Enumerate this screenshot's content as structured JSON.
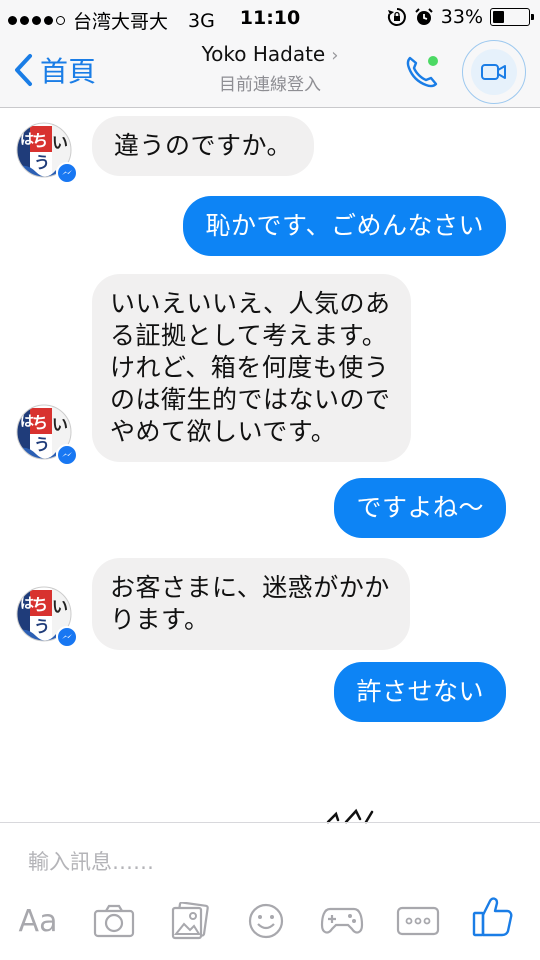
{
  "status_bar": {
    "carrier": "台湾大哥大",
    "network": "3G",
    "time": "11:10",
    "battery": "33%",
    "battery_level": 0.33
  },
  "header": {
    "back_label": "首頁",
    "contact_name": "Yoko Hadate",
    "contact_status": "目前連線登入"
  },
  "messages": [
    {
      "direction": "incoming",
      "text": "違うのですか。"
    },
    {
      "direction": "outgoing",
      "text": "恥かです、ごめんなさい"
    },
    {
      "direction": "incoming",
      "lines": [
        "いいえいいえ、人気のあ",
        "る証拠として考えます。",
        "けれど、箱を何度も使う",
        "のは衛生的ではないので",
        "やめて欲しいです。"
      ]
    },
    {
      "direction": "outgoing",
      "text": "ですよね〜"
    },
    {
      "direction": "incoming",
      "lines": [
        "お客さまに、迷惑がかか",
        "ります。"
      ]
    },
    {
      "direction": "outgoing",
      "text": "許させない"
    }
  ],
  "composer": {
    "placeholder": "輸入訊息……",
    "toolbar": {
      "text_label": "Aa",
      "icons": [
        "camera-icon",
        "gallery-icon",
        "emoji-icon",
        "game-icon",
        "more-icon",
        "like-icon"
      ]
    }
  },
  "colors": {
    "accent": "#1a7de6",
    "outgoing_bubble": "#0d84f5",
    "incoming_bubble": "#f1f0f0",
    "call_green": "#4cd964"
  }
}
